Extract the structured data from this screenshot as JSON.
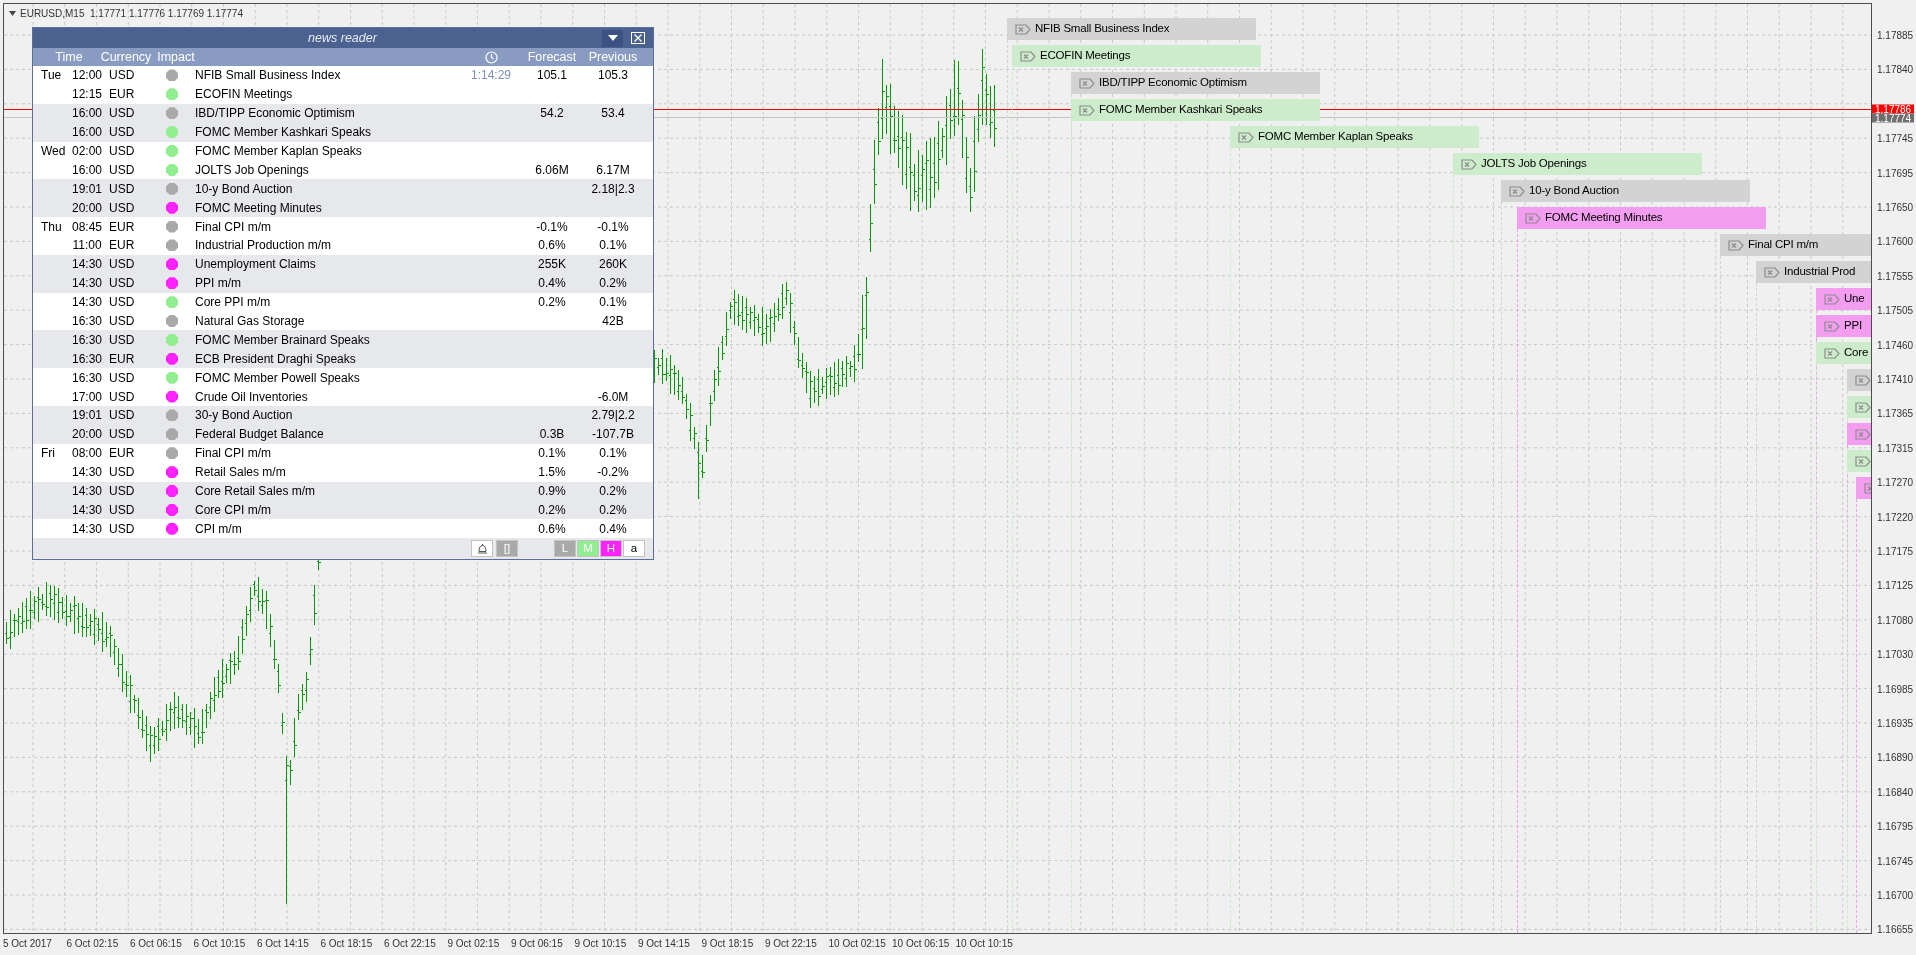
{
  "chart": {
    "info": "EURUSD,M15  1.17771 1.17776 1.17769 1.17774",
    "bid_label": "1.17786",
    "last_label": "1.17774",
    "price_labels": [
      "1.17885",
      "1.17840",
      "1.17745",
      "1.17695",
      "1.17650",
      "1.17600",
      "1.17555",
      "1.17505",
      "1.17460",
      "1.17410",
      "1.17365",
      "1.17315",
      "1.17270",
      "1.17220",
      "1.17175",
      "1.17125",
      "1.17080",
      "1.17030",
      "1.16985",
      "1.16935",
      "1.16890",
      "1.16840",
      "1.16795",
      "1.16745",
      "1.16700",
      "1.16655"
    ],
    "time_labels": [
      "5 Oct 2017",
      "6 Oct 02:15",
      "6 Oct 06:15",
      "6 Oct 10:15",
      "6 Oct 14:15",
      "6 Oct 18:15",
      "6 Oct 22:15",
      "9 Oct 02:15",
      "9 Oct 06:15",
      "9 Oct 10:15",
      "9 Oct 14:15",
      "9 Oct 18:15",
      "9 Oct 22:15",
      "10 Oct 02:15",
      "10 Oct 06:15",
      "10 Oct 10:15"
    ]
  },
  "news_reader": {
    "title": "news reader",
    "columns": [
      "Time",
      "Currency",
      "Impact",
      "Forecast",
      "Previous"
    ],
    "rows": [
      {
        "day": "Tue",
        "time": "12:00",
        "currency": "USD",
        "color": "#a9a9a9",
        "title": "NFIB Small Business Index",
        "countdown": "1:14:29",
        "forecast": "105.1",
        "previous": "105.3"
      },
      {
        "time": "12:15",
        "currency": "EUR",
        "color": "#90ee90",
        "title": "ECOFIN Meetings"
      },
      {
        "time": "16:00",
        "currency": "USD",
        "color": "#a9a9a9",
        "title": "IBD/TIPP Economic Optimism",
        "forecast": "54.2",
        "previous": "53.4"
      },
      {
        "time": "16:00",
        "currency": "USD",
        "color": "#90ee90",
        "title": "FOMC Member Kashkari Speaks"
      },
      {
        "day": "Wed",
        "time": "02:00",
        "currency": "USD",
        "color": "#90ee90",
        "title": "FOMC Member Kaplan Speaks"
      },
      {
        "time": "16:00",
        "currency": "USD",
        "color": "#90ee90",
        "title": "JOLTS Job Openings",
        "forecast": "6.06M",
        "previous": "6.17M"
      },
      {
        "time": "19:01",
        "currency": "USD",
        "color": "#a9a9a9",
        "title": "10-y Bond Auction",
        "previous": "2.18|2.3"
      },
      {
        "time": "20:00",
        "currency": "USD",
        "color": "#ff22ff",
        "title": "FOMC Meeting Minutes"
      },
      {
        "day": "Thu",
        "time": "08:45",
        "currency": "EUR",
        "color": "#a9a9a9",
        "title": "Final CPI m/m",
        "forecast": "-0.1%",
        "previous": "-0.1%"
      },
      {
        "time": "11:00",
        "currency": "EUR",
        "color": "#a9a9a9",
        "title": "Industrial Production m/m",
        "forecast": "0.6%",
        "previous": "0.1%"
      },
      {
        "time": "14:30",
        "currency": "USD",
        "color": "#ff22ff",
        "title": "Unemployment Claims",
        "forecast": "255K",
        "previous": "260K"
      },
      {
        "time": "14:30",
        "currency": "USD",
        "color": "#ff22ff",
        "title": "PPI m/m",
        "forecast": "0.4%",
        "previous": "0.2%"
      },
      {
        "time": "14:30",
        "currency": "USD",
        "color": "#90ee90",
        "title": "Core PPI m/m",
        "forecast": "0.2%",
        "previous": "0.1%"
      },
      {
        "time": "16:30",
        "currency": "USD",
        "color": "#a9a9a9",
        "title": "Natural Gas Storage",
        "previous": "42B"
      },
      {
        "time": "16:30",
        "currency": "USD",
        "color": "#90ee90",
        "title": "FOMC Member Brainard Speaks"
      },
      {
        "time": "16:30",
        "currency": "EUR",
        "color": "#ff22ff",
        "title": "ECB President Draghi Speaks"
      },
      {
        "time": "16:30",
        "currency": "USD",
        "color": "#90ee90",
        "title": "FOMC Member Powell Speaks"
      },
      {
        "time": "17:00",
        "currency": "USD",
        "color": "#ff22ff",
        "title": "Crude Oil Inventories",
        "previous": "-6.0M"
      },
      {
        "time": "19:01",
        "currency": "USD",
        "color": "#a9a9a9",
        "title": "30-y Bond Auction",
        "previous": "2.79|2.2"
      },
      {
        "time": "20:00",
        "currency": "USD",
        "color": "#a9a9a9",
        "title": "Federal Budget Balance",
        "forecast": "0.3B",
        "previous": "-107.7B"
      },
      {
        "day": "Fri",
        "time": "08:00",
        "currency": "EUR",
        "color": "#a9a9a9",
        "title": "Final CPI m/m",
        "forecast": "0.1%",
        "previous": "0.1%"
      },
      {
        "time": "14:30",
        "currency": "USD",
        "color": "#ff22ff",
        "title": "Retail Sales m/m",
        "forecast": "1.5%",
        "previous": "-0.2%"
      },
      {
        "time": "14:30",
        "currency": "USD",
        "color": "#ff22ff",
        "title": "Core Retail Sales m/m",
        "forecast": "0.9%",
        "previous": "0.2%"
      },
      {
        "time": "14:30",
        "currency": "USD",
        "color": "#ff22ff",
        "title": "Core CPI m/m",
        "forecast": "0.2%",
        "previous": "0.2%"
      },
      {
        "time": "14:30",
        "currency": "USD",
        "color": "#ff22ff",
        "title": "CPI m/m",
        "forecast": "0.6%",
        "previous": "0.4%"
      }
    ],
    "toolbar": [
      {
        "kind": "bell"
      },
      {
        "kind": "text",
        "label": "[]"
      },
      {
        "kind": "filter",
        "label": "L",
        "color": "#a9a9a9"
      },
      {
        "kind": "filter",
        "label": "M",
        "color": "#90ee90"
      },
      {
        "kind": "filter",
        "label": "H",
        "color": "#ff22ff"
      },
      {
        "kind": "filter",
        "label": "a",
        "color": "#ffffff"
      }
    ]
  },
  "events": [
    {
      "label": "NFIB Small Business Index",
      "color": "#d3d3d3"
    },
    {
      "label": "ECOFIN Meetings",
      "color": "#cdeccb"
    },
    {
      "label": "IBD/TIPP Economic Optimism",
      "color": "#d3d3d3"
    },
    {
      "label": "FOMC Member Kashkari Speaks",
      "color": "#cdeccb"
    },
    {
      "label": "FOMC Member Kaplan Speaks",
      "color": "#cdeccb"
    },
    {
      "label": "JOLTS Job Openings",
      "color": "#cdeccb"
    },
    {
      "label": "10-y Bond Auction",
      "color": "#d3d3d3"
    },
    {
      "label": "FOMC Meeting Minutes",
      "color": "#f39df0"
    },
    {
      "label": "Final CPI m/m",
      "color": "#d3d3d3"
    },
    {
      "label": "Industrial Prod",
      "color": "#d3d3d3"
    },
    {
      "label": "Une",
      "color": "#f39df0"
    },
    {
      "label": "PPI",
      "color": "#f39df0"
    },
    {
      "label": "Core",
      "color": "#cdeccb"
    },
    {
      "color": "#d3d3d3"
    },
    {
      "color": "#cdeccb"
    },
    {
      "color": "#f39df0"
    },
    {
      "color": "#cdeccb"
    },
    {
      "color": "#f39df0"
    }
  ]
}
